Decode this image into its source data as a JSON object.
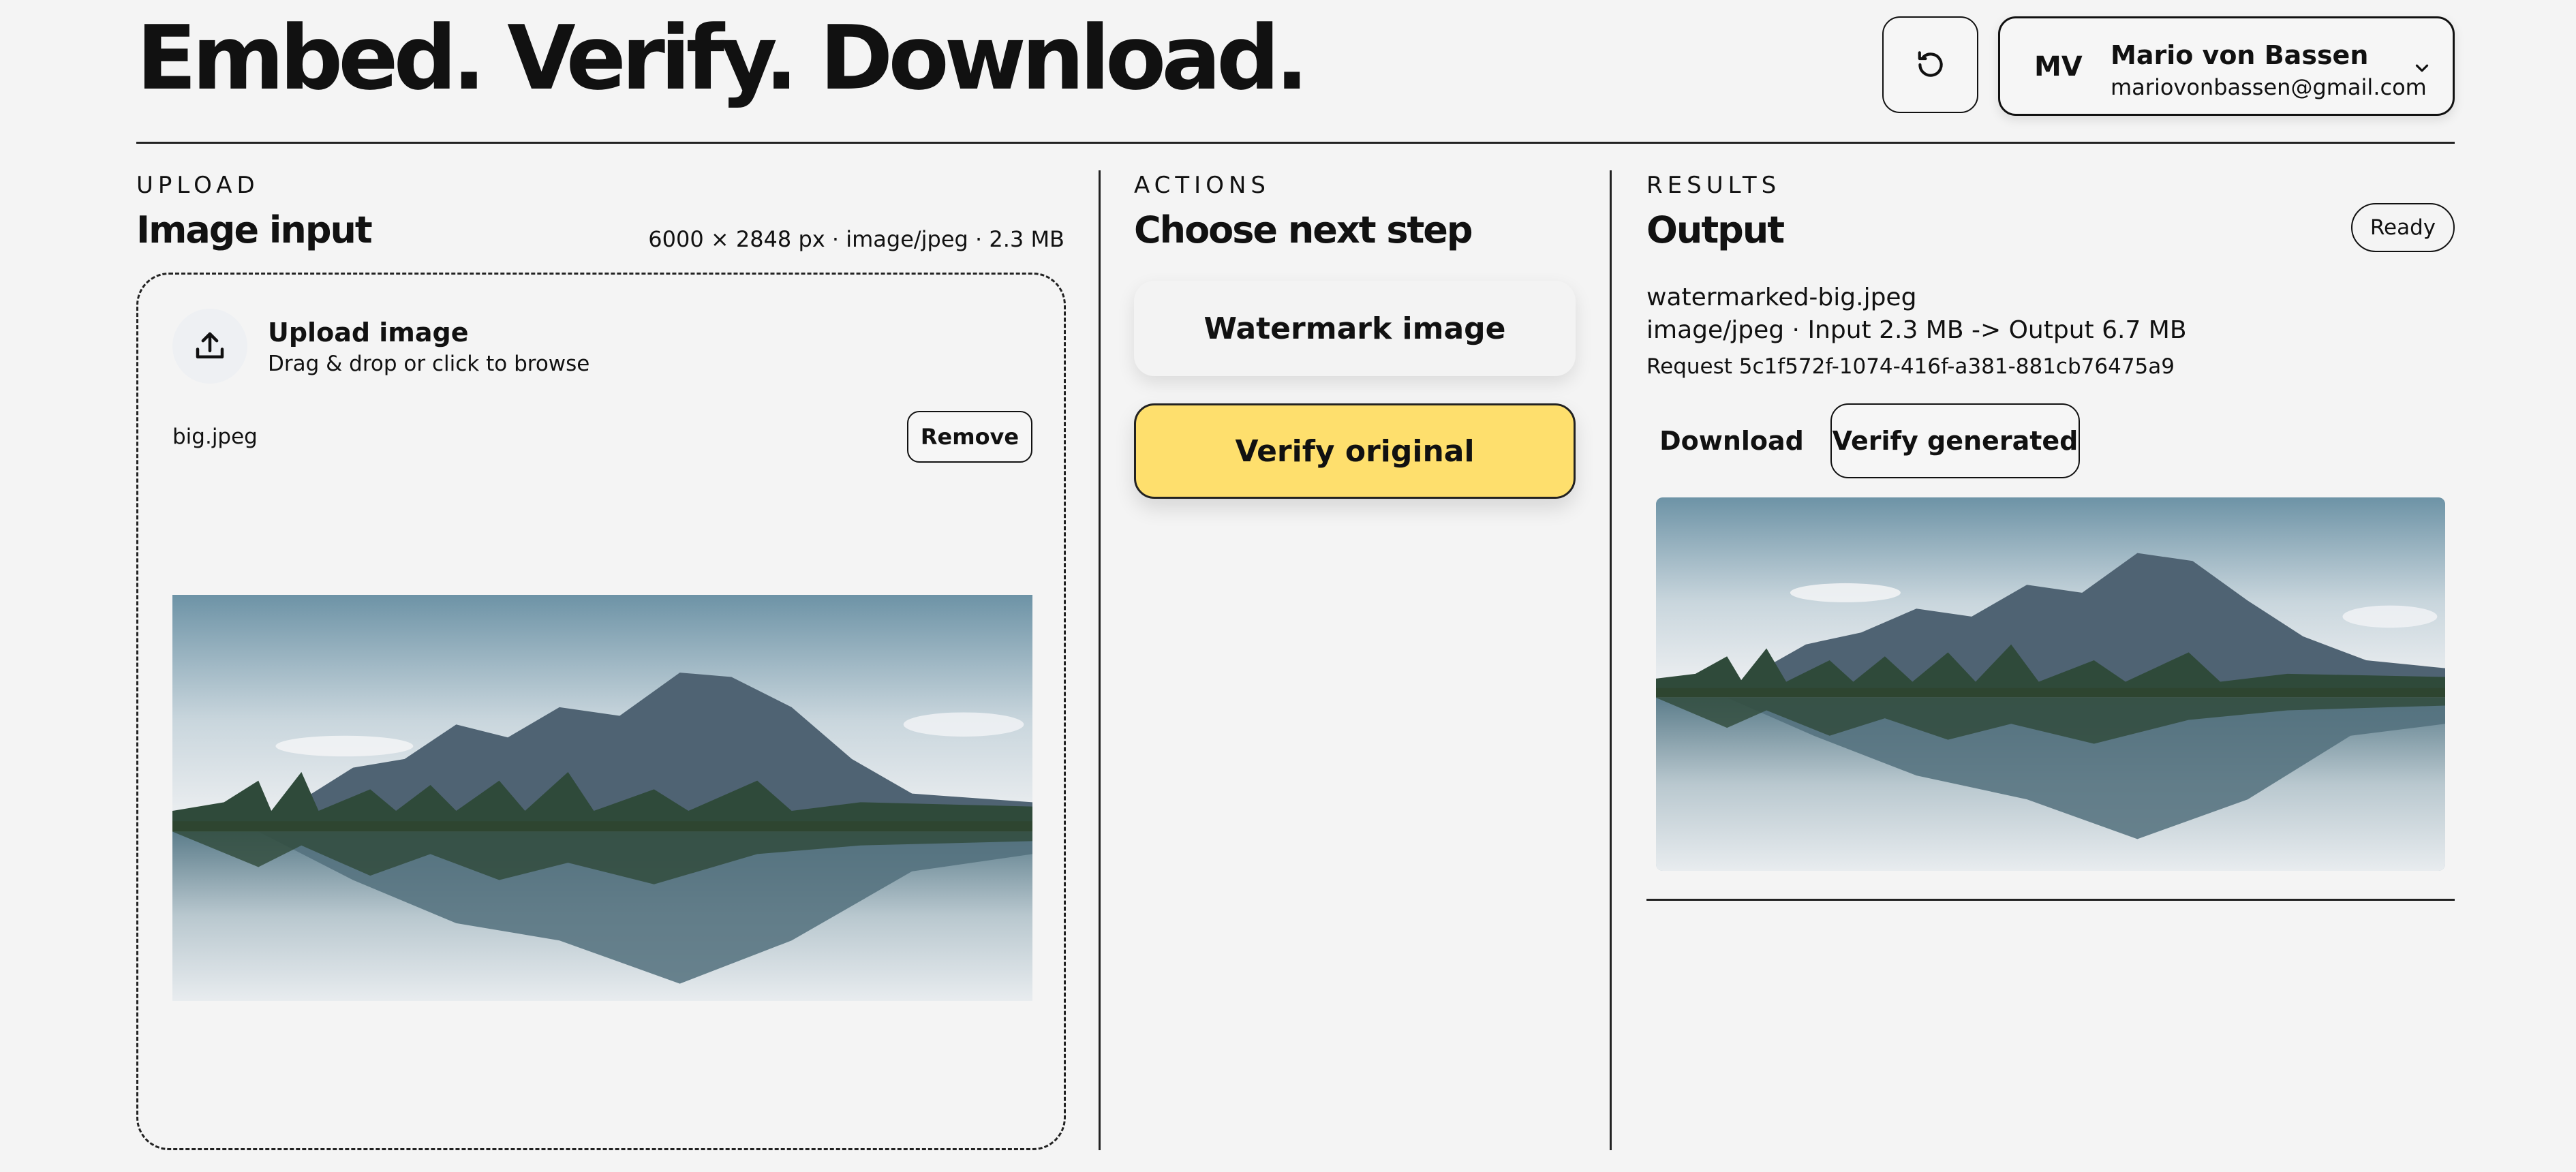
{
  "header": {
    "title": "Embed. Verify. Download.",
    "refresh_icon": "refresh-icon",
    "user": {
      "initials": "MV",
      "name": "Mario von Bassen",
      "email": "mariovonbassen@gmail.com",
      "menu_icon": "chevron-down-icon"
    }
  },
  "upload": {
    "eyebrow": "UPLOAD",
    "heading": "Image input",
    "meta": "6000 × 2848 px · image/jpeg · 2.3 MB",
    "dropzone": {
      "icon": "upload-icon",
      "title": "Upload image",
      "subtitle": "Drag & drop or click to browse"
    },
    "file_name": "big.jpeg",
    "remove_label": "Remove"
  },
  "actions": {
    "eyebrow": "ACTIONS",
    "heading": "Choose next step",
    "watermark_label": "Watermark image",
    "verify_label": "Verify original"
  },
  "results": {
    "eyebrow": "RESULTS",
    "heading": "Output",
    "status": "Ready",
    "output_name": "watermarked-big.jpeg",
    "output_meta": "image/jpeg · Input 2.3 MB -> Output 6.7 MB",
    "request": "Request 5c1f572f-1074-416f-a381-881cb76475a9",
    "download_label": "Download",
    "verify_generated_label": "Verify generated"
  },
  "colors": {
    "accent_yellow": "#fedf6d",
    "background": "#f4f4f4",
    "ink": "#111111"
  }
}
